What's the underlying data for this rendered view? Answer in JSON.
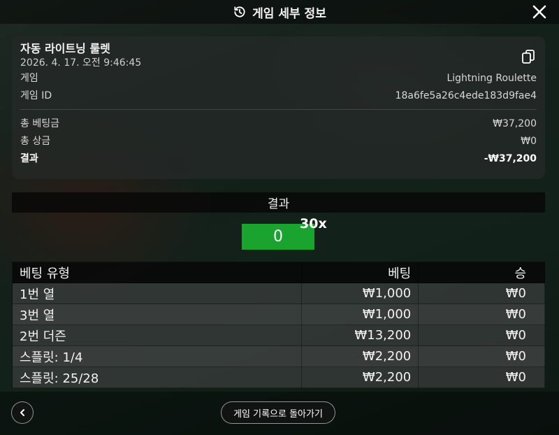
{
  "header": {
    "title": "게임 세부 정보",
    "history_icon": "history-icon",
    "close_icon": "close-icon"
  },
  "summary": {
    "game_title": "자동 라이트닝 룰렛",
    "datetime": "2026. 4. 17. 오전 9:46:45",
    "copy_icon": "copy-icon",
    "game_label": "게임",
    "game_value": "Lightning Roulette",
    "game_id_label": "게임 ID",
    "game_id_value": "18a6fe5a26c4ede183d9fae4",
    "total_bet_label": "총 베팅금",
    "total_bet_value": "₩37,200",
    "total_win_label": "총 상금",
    "total_win_value": "₩0",
    "result_label": "결과",
    "result_value": "-₩37,200"
  },
  "result": {
    "heading": "결과",
    "number": "0",
    "number_color": "#1aa32f",
    "multiplier": "30x"
  },
  "bets_table": {
    "headers": [
      "베팅 유형",
      "베팅",
      "승"
    ],
    "rows": [
      [
        "1번 열",
        "₩1,000",
        "₩0"
      ],
      [
        "3번 열",
        "₩1,000",
        "₩0"
      ],
      [
        "2번 더즌",
        "₩13,200",
        "₩0"
      ],
      [
        "스플릿: 1/4",
        "₩2,200",
        "₩0"
      ],
      [
        "스플릿: 25/28",
        "₩2,200",
        "₩0"
      ]
    ]
  },
  "footer": {
    "back_icon": "chevron-left-icon",
    "history_button": "게임 기록으로 돌아가기"
  }
}
